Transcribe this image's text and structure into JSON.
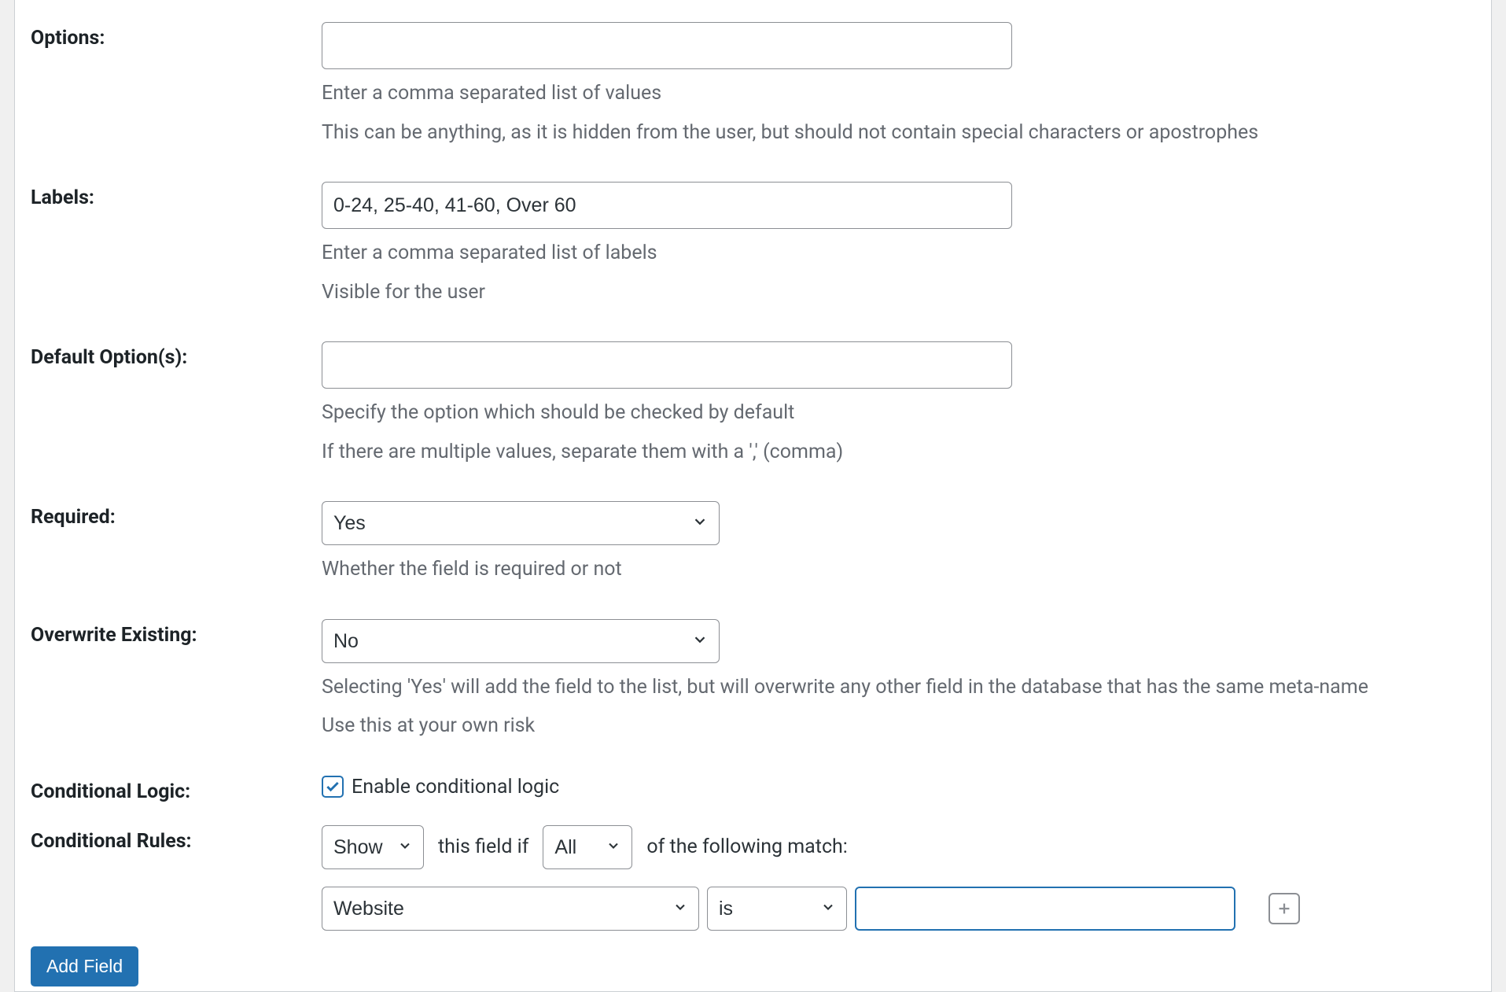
{
  "fields": {
    "options": {
      "label": "Options:",
      "value": "",
      "help1": "Enter a comma separated list of values",
      "help2": "This can be anything, as it is hidden from the user, but should not contain special characters or apostrophes"
    },
    "labels": {
      "label": "Labels:",
      "value": "0-24, 25-40, 41-60, Over 60",
      "help1": "Enter a comma separated list of labels",
      "help2": "Visible for the user"
    },
    "default_options": {
      "label": "Default Option(s):",
      "value": "",
      "help1": "Specify the option which should be checked by default",
      "help2": "If there are multiple values, separate them with a ',' (comma)"
    },
    "required": {
      "label": "Required:",
      "value": "Yes",
      "help": "Whether the field is required or not"
    },
    "overwrite": {
      "label": "Overwrite Existing:",
      "value": "No",
      "help1": "Selecting 'Yes' will add the field to the list, but will overwrite any other field in the database that has the same meta-name",
      "help2": "Use this at your own risk"
    },
    "conditional_logic": {
      "label": "Conditional Logic:",
      "checkbox_label": "Enable conditional logic",
      "checked": true
    },
    "conditional_rules": {
      "label": "Conditional Rules:",
      "action": "Show",
      "text1": "this field if",
      "match": "All",
      "text2": "of the following match:",
      "rule_field": "Website",
      "rule_op": "is",
      "rule_value": ""
    }
  },
  "buttons": {
    "add_field": "Add Field"
  }
}
